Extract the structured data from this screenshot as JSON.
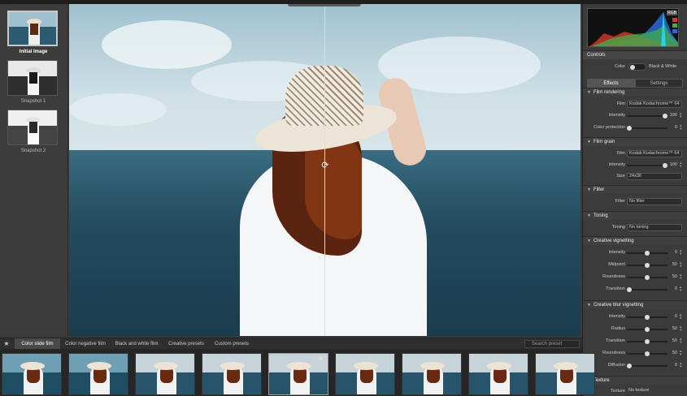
{
  "snapshots": [
    {
      "label": "Initial Image",
      "selected": true
    },
    {
      "label": "Snapshot 1",
      "selected": false
    },
    {
      "label": "Snapshot 2",
      "selected": false
    }
  ],
  "histogram": {
    "mode_label": "RGB"
  },
  "controls": {
    "title": "Controls",
    "color_label": "Color",
    "bw_label": "Black & White",
    "tabs": [
      {
        "label": "Effects",
        "active": true
      },
      {
        "label": "Settings",
        "active": false
      }
    ]
  },
  "film_rendering": {
    "title": "Film rendering",
    "film_label": "Film",
    "film_value": "Kodak Kodachrome™ 64",
    "intensity_label": "Intensity",
    "intensity_value": "100",
    "color_protection_label": "Color protection",
    "color_protection_value": "0"
  },
  "film_grain": {
    "title": "Film grain",
    "film_label": "Film",
    "film_value": "Kodak Kodachrome™ 64",
    "intensity_label": "Intensity",
    "intensity_value": "100",
    "size_label": "Size",
    "size_value": "24x36"
  },
  "filter": {
    "title": "Filter",
    "filter_label": "Filter",
    "filter_value": "No filter"
  },
  "toning": {
    "title": "Toning",
    "toning_label": "Toning",
    "toning_value": "No toning"
  },
  "creative_vignetting": {
    "title": "Creative vignetting",
    "rows": [
      {
        "label": "Intensity",
        "value": "0",
        "level": 0.5
      },
      {
        "label": "Midpoint",
        "value": "50",
        "level": 0.5
      },
      {
        "label": "Roundness",
        "value": "50",
        "level": 0.5
      },
      {
        "label": "Transition",
        "value": "0",
        "level": 0
      }
    ]
  },
  "creative_blur": {
    "title": "Creative blur vignetting",
    "rows": [
      {
        "label": "Intensity",
        "value": "0",
        "level": 0.5
      },
      {
        "label": "Radius",
        "value": "50",
        "level": 0.5
      },
      {
        "label": "Transition",
        "value": "50",
        "level": 0.5
      },
      {
        "label": "Roundness",
        "value": "50",
        "level": 0.5
      },
      {
        "label": "Diffusion",
        "value": "0",
        "level": 0
      }
    ]
  },
  "texture": {
    "title": "Texture",
    "texture_label": "Texture",
    "texture_value": "No texture"
  },
  "presets": {
    "tabs": [
      {
        "label": "Color slide film",
        "active": true
      },
      {
        "label": "Color negative film",
        "active": false
      },
      {
        "label": "Black and white film",
        "active": false
      },
      {
        "label": "Creative presets",
        "active": false
      },
      {
        "label": "Custom presets",
        "active": false
      }
    ],
    "search_placeholder": "Search preset",
    "thumbnail_count": 9,
    "selected_index": 4
  },
  "colors": {
    "accent": "#c8c8c8",
    "panel": "#3b3b3b",
    "knob": "#dddddd"
  }
}
